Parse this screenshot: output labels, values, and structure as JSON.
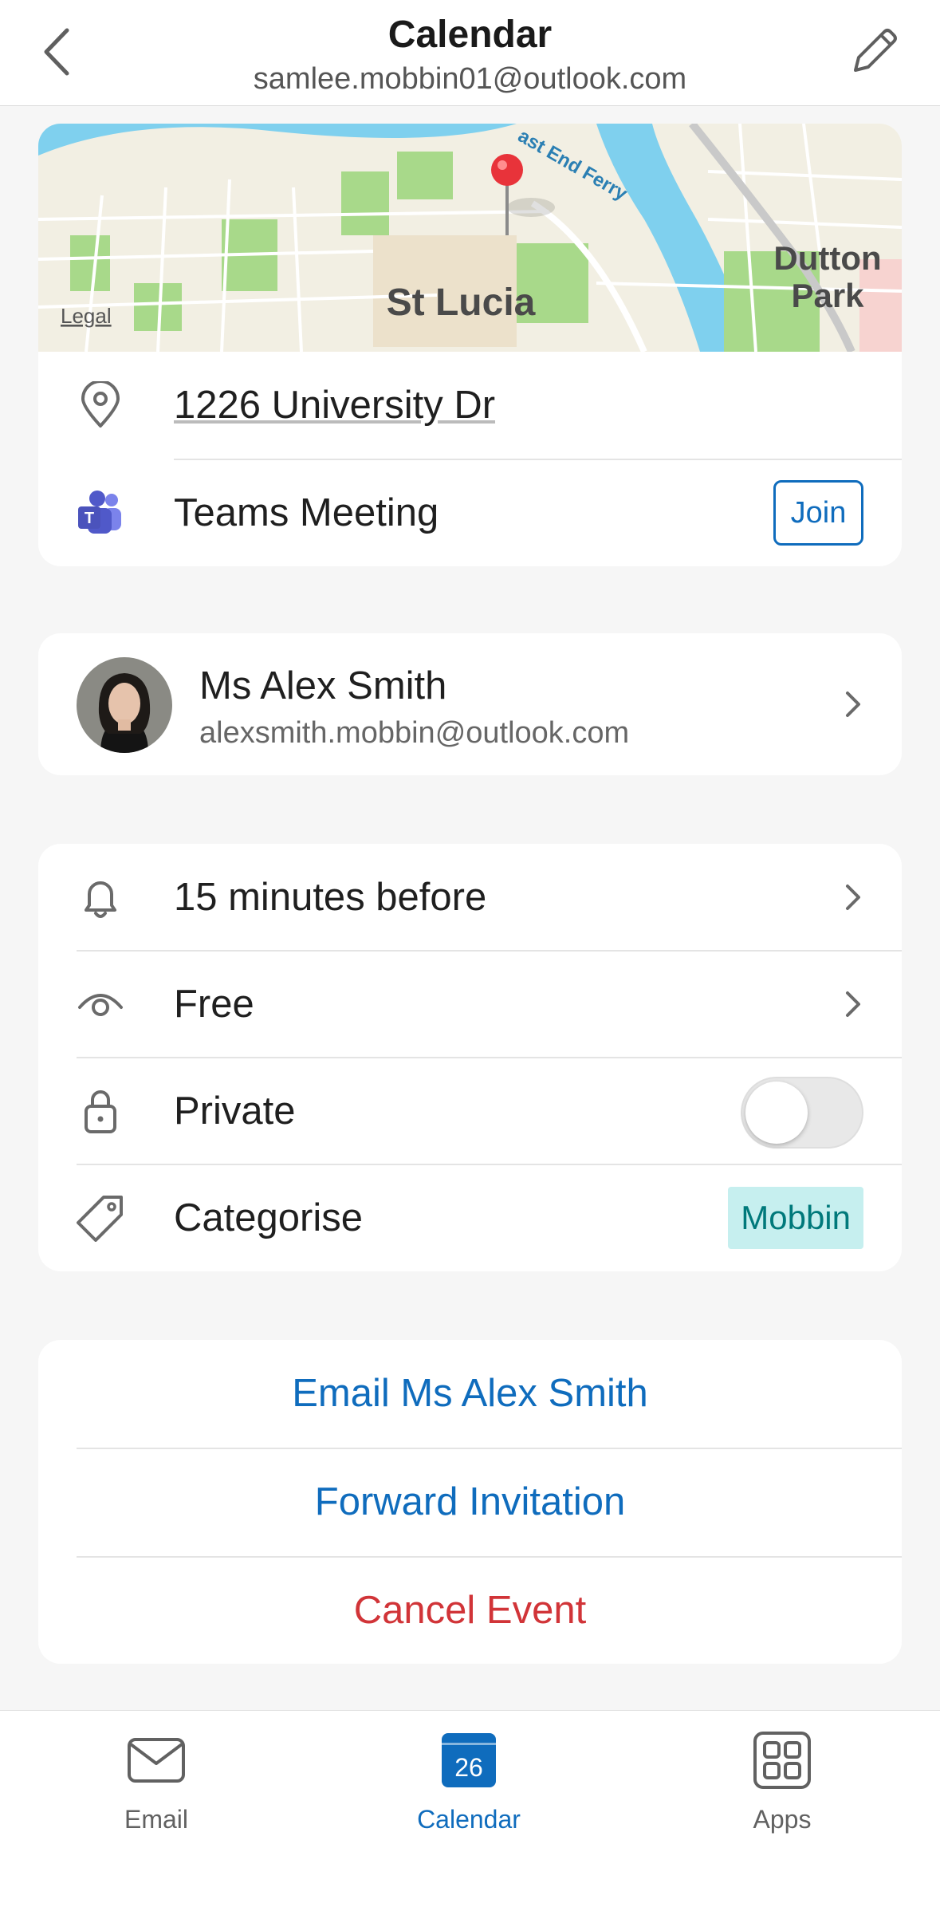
{
  "header": {
    "title": "Calendar",
    "account": "samlee.mobbin01@outlook.com"
  },
  "map": {
    "labels": {
      "suburb": "St Lucia",
      "suburb2_line1": "Dutton",
      "suburb2_line2": "Park",
      "ferry": "ast End Ferry",
      "legal": "Legal"
    }
  },
  "location": {
    "address": "1226 University Dr",
    "meeting_label": "Teams Meeting",
    "join_label": "Join"
  },
  "organizer": {
    "name": "Ms Alex Smith",
    "email": "alexsmith.mobbin@outlook.com"
  },
  "settings": {
    "reminder": "15 minutes before",
    "show_as": "Free",
    "private_label": "Private",
    "private_on": false,
    "categorise_label": "Categorise",
    "category": "Mobbin"
  },
  "actions": {
    "email": "Email Ms Alex Smith",
    "forward": "Forward Invitation",
    "cancel": "Cancel Event"
  },
  "tabbar": {
    "email": "Email",
    "calendar": "Calendar",
    "calendar_day": "26",
    "apps": "Apps"
  },
  "colors": {
    "accent": "#0f6cbd",
    "destructive": "#d13438",
    "category_bg": "#c6efef",
    "category_text": "#00797b",
    "map_water": "#7fd0ee",
    "map_park": "#a8d98a",
    "map_land": "#f2efe3"
  }
}
